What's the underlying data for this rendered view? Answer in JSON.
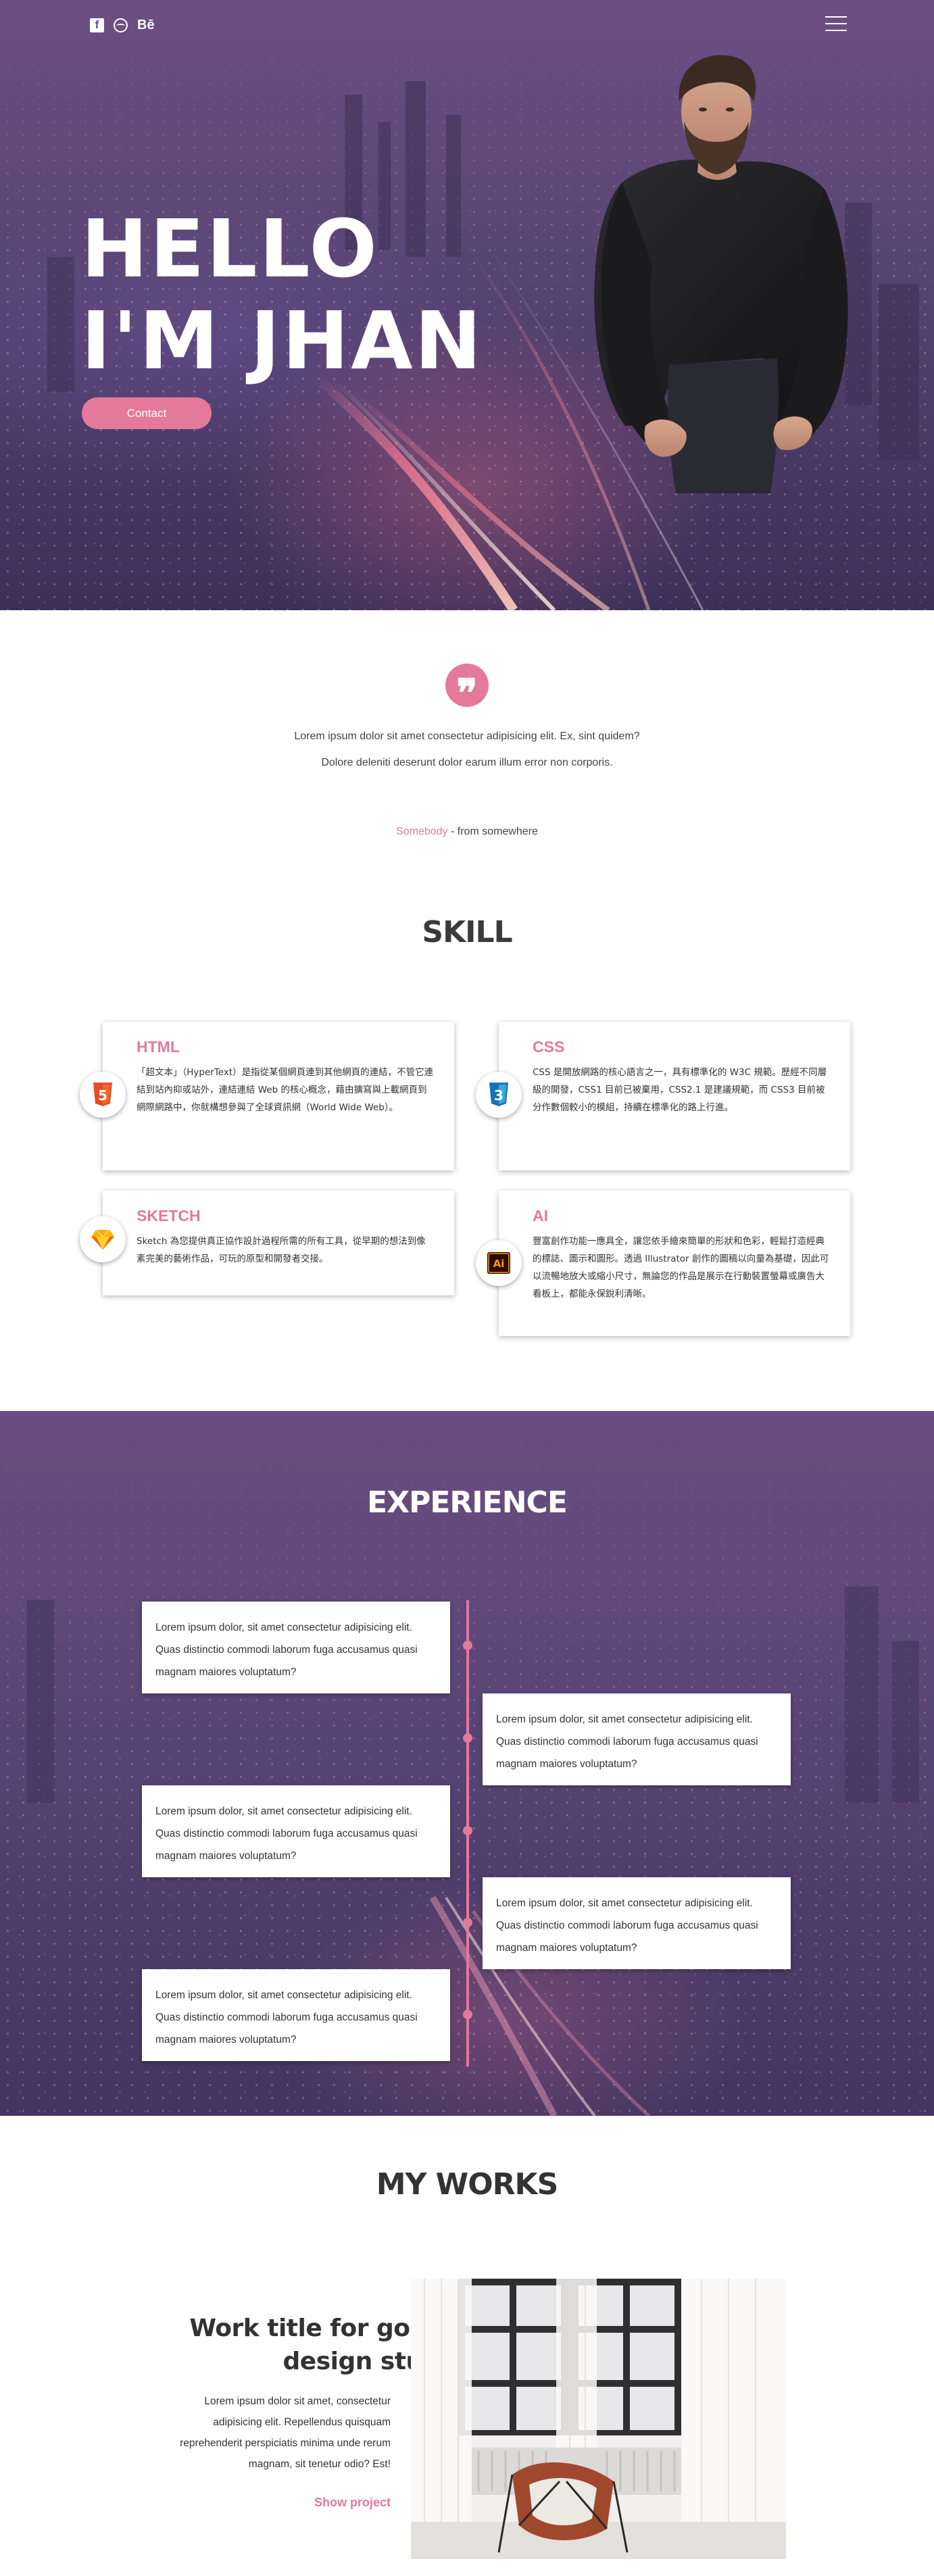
{
  "hero": {
    "social": [
      "f",
      "",
      "Bē"
    ],
    "title_line1": "HELLO",
    "title_line2": "I'M JHAN",
    "contact_label": "Contact"
  },
  "quote": {
    "mark": "❞",
    "text": "Lorem ipsum dolor sit amet consectetur adipisicing elit. Ex, sint quidem? Dolore deleniti deserunt dolor earum illum error non corporis.",
    "author": "Somebody",
    "source": " - from somewhere"
  },
  "skill": {
    "title": "SKILL",
    "items": [
      {
        "name": "HTML",
        "icon": "html5-icon",
        "text": "「超文本」（HyperText）是指從某個網頁連到其他網頁的連結，不管它連結到站內抑或站外，連結連結 Web 的核心概念，藉由擴寫與上載網頁到網際網路中，你就構想參與了全球資訊網（World Wide Web）。"
      },
      {
        "name": "CSS",
        "icon": "css3-icon",
        "text": "CSS 是開放網路的核心語言之一，具有標準化的 W3C 規範。歷經不同層級的開發，CSS1 目前已被棄用，CSS2.1 是建議規範，而 CSS3 目前被分作數個較小的模組，持續在標準化的路上行進。"
      },
      {
        "name": "SKETCH",
        "icon": "sketch-icon",
        "text": "Sketch 為您提供真正協作設計過程所需的所有工具，從早期的想法到像素完美的藝術作品，可玩的原型和開發者交接。"
      },
      {
        "name": "AI",
        "icon": "illustrator-icon",
        "text": "豐富創作功能一應具全，讓您依手繪來簡單的形狀和色彩，輕鬆打造經典的標誌、圖示和圖形。透過 Illustrator 創作的圖稿以向量為基礎，因此可以流暢地放大或縮小尺寸，無論您的作品是展示在行動裝置螢幕或廣告大看板上，都能永保銳利清晰。"
      }
    ]
  },
  "experience": {
    "title": "EXPERIENCE",
    "items": [
      "Lorem ipsum dolor, sit amet consectetur adipisicing elit. Quas distinctio commodi laborum fuga accusamus quasi magnam maiores voluptatum?",
      "Lorem ipsum dolor, sit amet consectetur adipisicing elit. Quas distinctio commodi laborum fuga accusamus quasi magnam maiores voluptatum?",
      "Lorem ipsum dolor, sit amet consectetur adipisicing elit. Quas distinctio commodi laborum fuga accusamus quasi magnam maiores voluptatum?",
      "Lorem ipsum dolor, sit amet consectetur adipisicing elit. Quas distinctio commodi laborum fuga accusamus quasi magnam maiores voluptatum?",
      "Lorem ipsum dolor, sit amet consectetur adipisicing elit. Quas distinctio commodi laborum fuga accusamus quasi magnam maiores voluptatum?"
    ]
  },
  "works": {
    "title": "MY WORKS",
    "work_title": "Work title for good design stuff",
    "description": "Lorem ipsum dolor sit amet, consectetur adipisicing elit. Repellendus quisquam reprehenderit perspiciatis minima unde rerum magnam, sit tenetur odio? Est!",
    "show_project": "Show project"
  },
  "colors": {
    "accent": "#e4799c",
    "hero_overlay": "#6d4e83",
    "text_dark": "#333333"
  }
}
